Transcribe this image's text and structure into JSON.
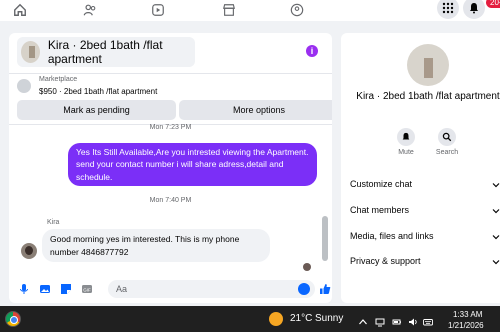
{
  "topnav": {
    "icons": [
      "home-icon",
      "friends-icon",
      "video-icon",
      "marketplace-icon",
      "groups-icon",
      "menu-grid-icon",
      "messenger-icon",
      "notifications-icon"
    ],
    "notif_count": "20+"
  },
  "chat": {
    "title": "Kira · 2bed 1bath /flat apartment",
    "marketplace_label": "Marketplace",
    "listing_summary": "$950 · 2bed 1bath /flat apartment",
    "mark_pending": "Mark as pending",
    "more_options": "More options",
    "timestamp_top": "Mon 7:23 PM",
    "outgoing_message": "Yes Its Still Available,Are you intrested viewing the Apartment. send your contact number i will share adress,detail and schedule.",
    "timestamp_mid": "Mon 7:40 PM",
    "sender_name": "Kira",
    "incoming_message": "Good morning yes im interested. This is my phone number 4846877792",
    "input_placeholder": "Aa"
  },
  "info_panel": {
    "title": "Kira · 2bed 1bath /flat apartment",
    "mute_label": "Mute",
    "search_label": "Search",
    "sections": [
      "Customize chat",
      "Chat members",
      "Media, files and links",
      "Privacy & support"
    ]
  },
  "taskbar": {
    "temperature": "21°C",
    "condition": "Sunny",
    "time": "1:33 AM",
    "date": "1/21/2026"
  },
  "colors": {
    "accent": "#7b2ff7",
    "fb_blue": "#0866ff",
    "taskbar_bg": "#202020"
  }
}
